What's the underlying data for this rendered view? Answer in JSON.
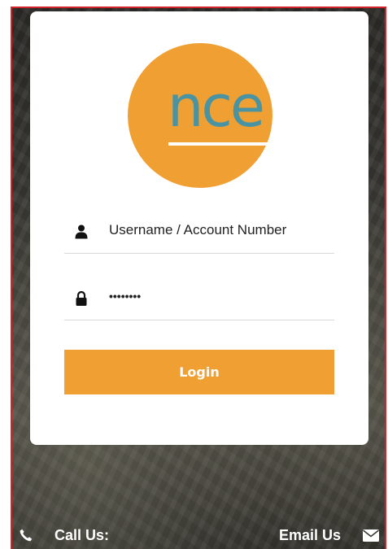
{
  "logo": {
    "text": "nce",
    "color_bg": "#f0a033",
    "color_text": "#4a93a3"
  },
  "form": {
    "username": {
      "placeholder": "Username / Account Number",
      "icon": "user-icon"
    },
    "password": {
      "value": "••••••••",
      "icon": "lock-icon"
    },
    "login_label": "Login"
  },
  "footer": {
    "call_label": "Call Us:",
    "call_icon": "phone-icon",
    "email_label": "Email Us",
    "email_icon": "envelope-icon"
  },
  "colors": {
    "accent": "#f0a033",
    "frame_border": "#d2232a"
  }
}
